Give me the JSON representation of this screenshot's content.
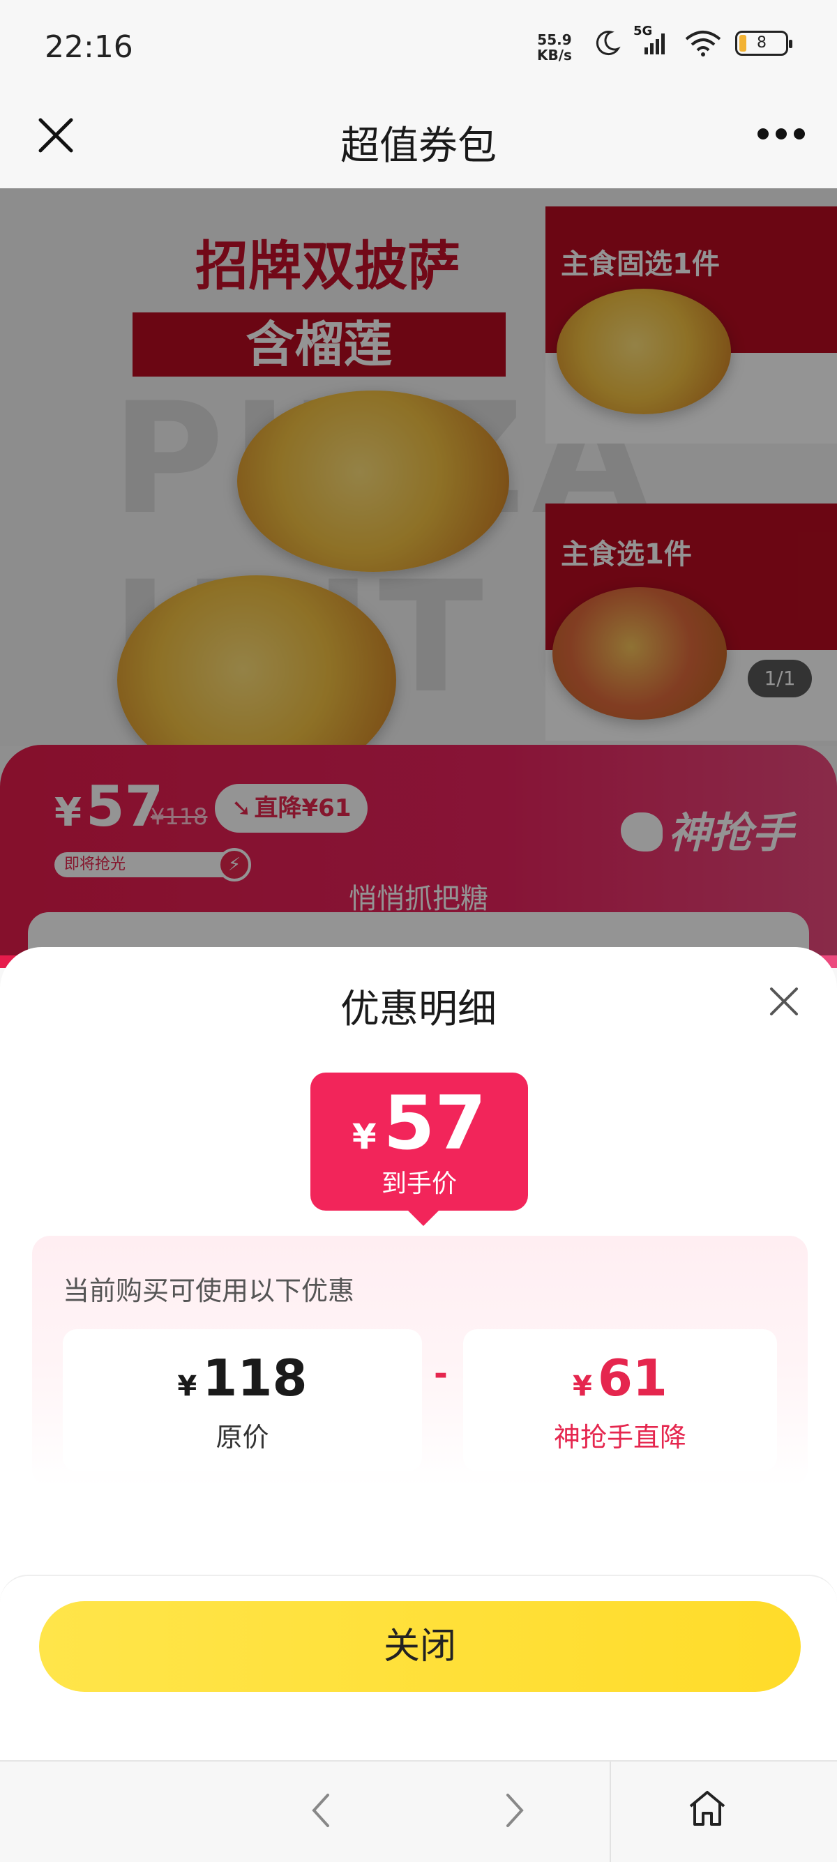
{
  "status_bar": {
    "time": "22:16",
    "net_speed_value": "55.9",
    "net_speed_unit": "KB/s",
    "signal_label": "5G",
    "battery": "8"
  },
  "header": {
    "title": "超值券包"
  },
  "banner": {
    "headline": "招牌双披萨",
    "subheadline": "含榴莲",
    "watermark": "PIZZA HUT",
    "side_card_1": "主食固选1件",
    "side_card_2": "主食选1件",
    "pager": "1/1"
  },
  "promo": {
    "currency": "¥",
    "price": "57",
    "original_price": "¥118",
    "drop_label": "直降¥61",
    "stock_label": "即将抢光",
    "brand": "神抢手",
    "tagline": "悄悄抓把糖"
  },
  "sheet": {
    "title": "优惠明细",
    "final_currency": "¥",
    "final_price": "57",
    "final_label": "到手价",
    "hint": "当前购买可使用以下优惠",
    "items": [
      {
        "currency": "¥",
        "amount": "118",
        "label": "原价"
      },
      {
        "currency": "¥",
        "amount": "61",
        "label": "神抢手直降"
      }
    ],
    "operator": "-",
    "close_button": "关闭"
  },
  "colors": {
    "accent_red": "#f2255a",
    "button_yellow": "#ffdc2a",
    "brand_red": "#b80c21"
  }
}
